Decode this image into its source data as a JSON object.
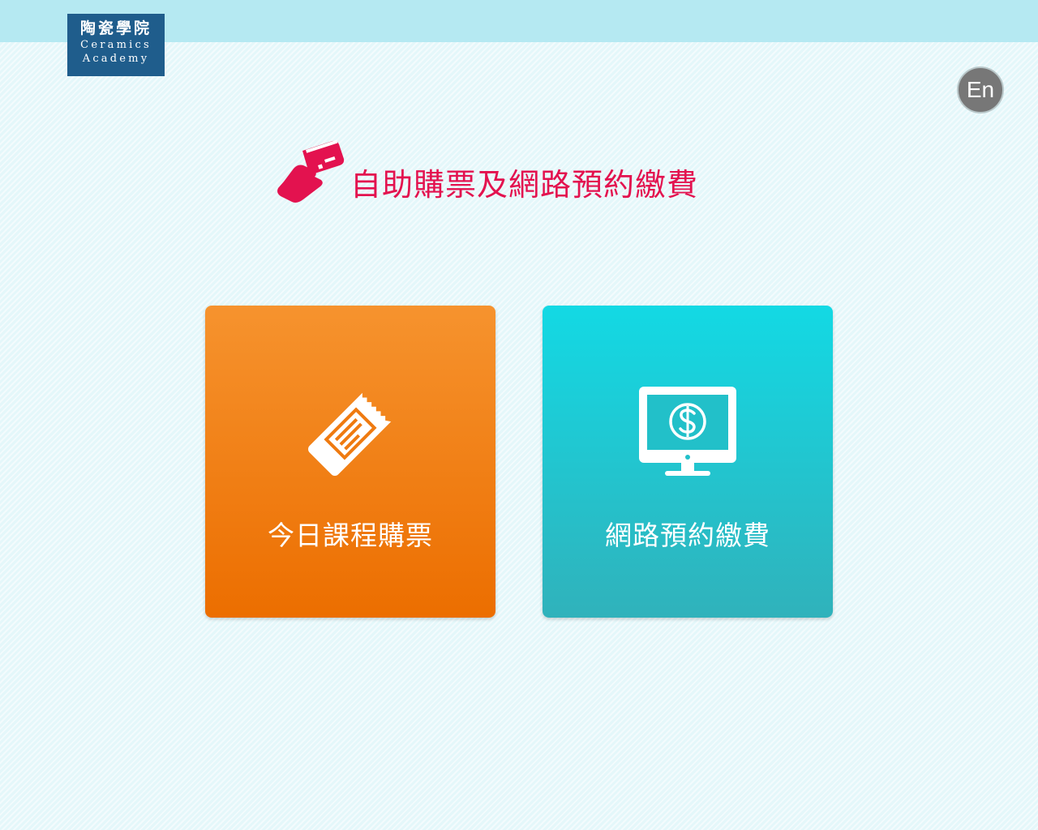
{
  "header": {
    "logo_zh": "陶瓷學院",
    "logo_en_line1": "Ceramics",
    "logo_en_line2": "Academy",
    "language_button": "En"
  },
  "main": {
    "heading_icon": "card-in-hand-icon",
    "heading": "自助購票及網路預約繳費",
    "tiles": [
      {
        "label": "今日課程購票",
        "icon": "ticket-icon",
        "color": "#ef7a10"
      },
      {
        "label": "網路預約繳費",
        "icon": "monitor-dollar-icon",
        "color": "#1fc7d1"
      }
    ]
  },
  "colors": {
    "accent": "#e3124f",
    "top_bar": "#b5e9f2",
    "logo_bg": "#1f5d8c"
  }
}
